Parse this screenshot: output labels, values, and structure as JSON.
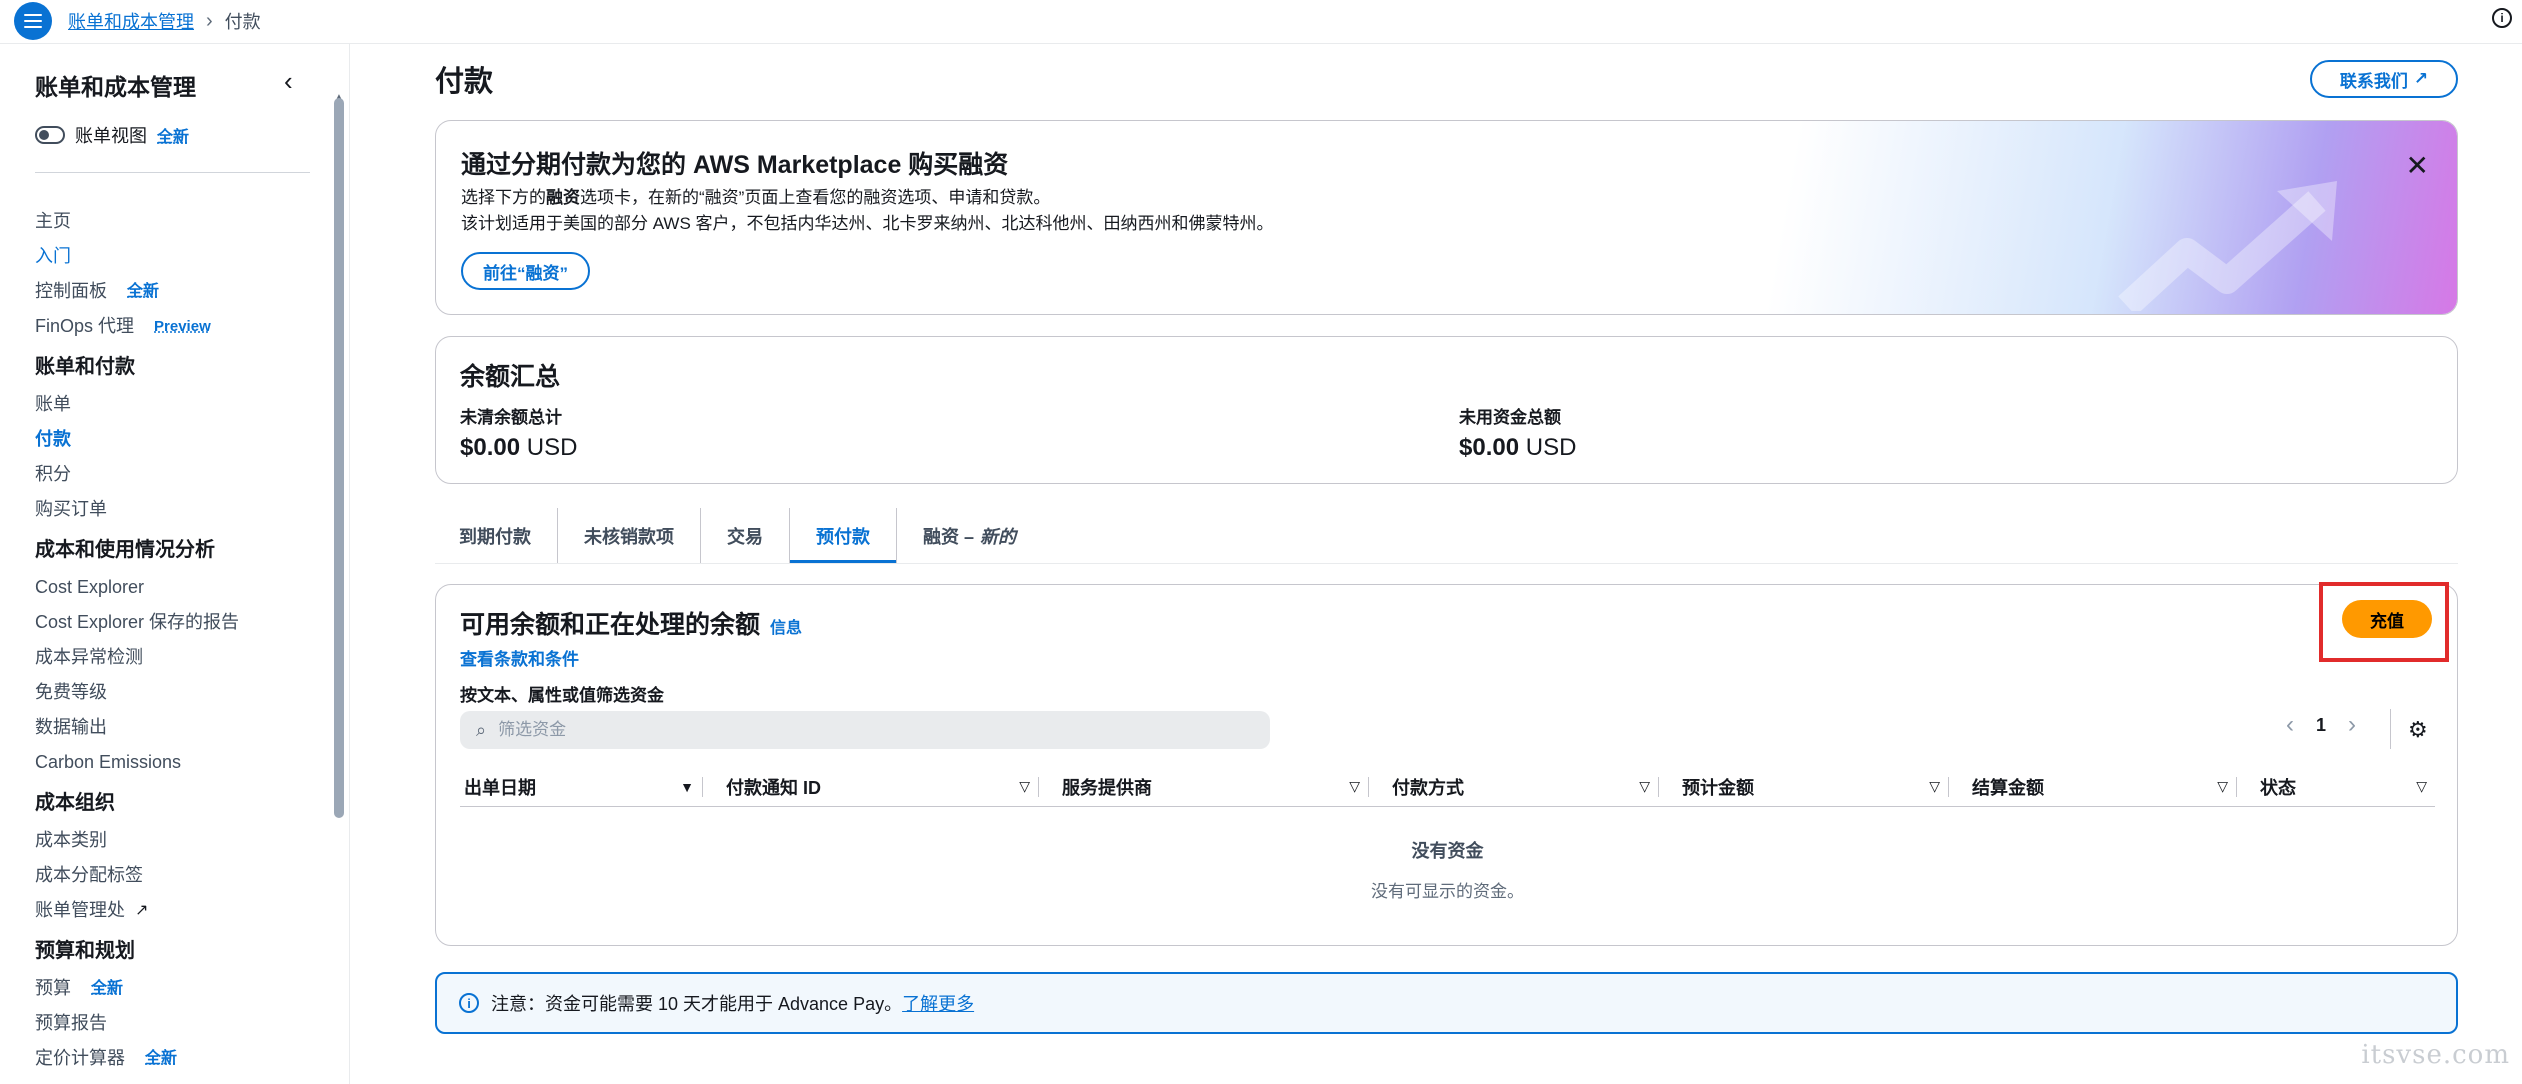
{
  "topbar": {
    "breadcrumb_root": "账单和成本管理",
    "breadcrumb_sep": "›",
    "breadcrumb_current": "付款",
    "info_icon": "i"
  },
  "sidebar": {
    "title": "账单和成本管理",
    "collapse_icon": "‹",
    "toggle_label": "账单视图",
    "new_badge": "全新",
    "items": [
      {
        "label": "主页",
        "type": "item"
      },
      {
        "label": "入门",
        "type": "link"
      },
      {
        "label": "控制面板",
        "type": "item",
        "badge": "全新"
      },
      {
        "label": "FinOps 代理",
        "type": "item",
        "badge": "Preview"
      },
      {
        "label": "账单和付款",
        "type": "head"
      },
      {
        "label": "账单",
        "type": "item"
      },
      {
        "label": "付款",
        "type": "active"
      },
      {
        "label": "积分",
        "type": "item"
      },
      {
        "label": "购买订单",
        "type": "item"
      },
      {
        "label": "成本和使用情况分析",
        "type": "head"
      },
      {
        "label": "Cost Explorer",
        "type": "item"
      },
      {
        "label": "Cost Explorer 保存的报告",
        "type": "item"
      },
      {
        "label": "成本异常检测",
        "type": "item"
      },
      {
        "label": "免费等级",
        "type": "item"
      },
      {
        "label": "数据输出",
        "type": "item"
      },
      {
        "label": "Carbon Emissions",
        "type": "item"
      },
      {
        "label": "成本组织",
        "type": "head"
      },
      {
        "label": "成本类别",
        "type": "item"
      },
      {
        "label": "成本分配标签",
        "type": "item"
      },
      {
        "label": "账单管理处",
        "type": "item",
        "external": true
      },
      {
        "label": "预算和规划",
        "type": "head"
      },
      {
        "label": "预算",
        "type": "item",
        "badge": "全新"
      },
      {
        "label": "预算报告",
        "type": "item"
      },
      {
        "label": "定价计算器",
        "type": "item",
        "badge": "全新"
      }
    ]
  },
  "page": {
    "title": "付款",
    "contact_button": "联系我们"
  },
  "banner": {
    "title": "通过分期付款为您的 AWS Marketplace 购买融资",
    "line1_a": "选择下方的",
    "line1_b": "融资",
    "line1_c": "选项卡，在新的“融资”页面上查看您的融资选项、申请和贷款。",
    "line2": "该计划适用于美国的部分 AWS 客户，不包括内华达州、北卡罗来纳州、北达科他州、田纳西州和佛蒙特州。",
    "button": "前往“融资”",
    "close_icon": "✕"
  },
  "balance": {
    "title": "余额汇总",
    "outstanding_label": "未清余额总计",
    "outstanding_amount": "$0.00",
    "outstanding_currency": "USD",
    "unused_label": "未用资金总额",
    "unused_amount": "$0.00",
    "unused_currency": "USD"
  },
  "tabs": [
    {
      "label": "到期付款"
    },
    {
      "label": "未核销款项"
    },
    {
      "label": "交易"
    },
    {
      "label": "预付款",
      "active": true
    },
    {
      "label": "融资 –",
      "suffix": "新的"
    }
  ],
  "funds": {
    "title": "可用余额和正在处理的余额",
    "info_link": "信息",
    "terms_link": "查看条款和条件",
    "filter_label": "按文本、属性或值筛选资金",
    "search_placeholder": "筛选资金",
    "recharge_button": "充值",
    "page_number": "1",
    "columns": [
      "出单日期",
      "付款通知 ID",
      "服务提供商",
      "付款方式",
      "预计金额",
      "结算金额",
      "状态"
    ],
    "empty_title": "没有资金",
    "empty_subtitle": "没有可显示的资金。"
  },
  "notice": {
    "text": "注意：资金可能需要 10 天才能用于 Advance Pay。",
    "link": "了解更多"
  },
  "watermark": "itsvse.com"
}
